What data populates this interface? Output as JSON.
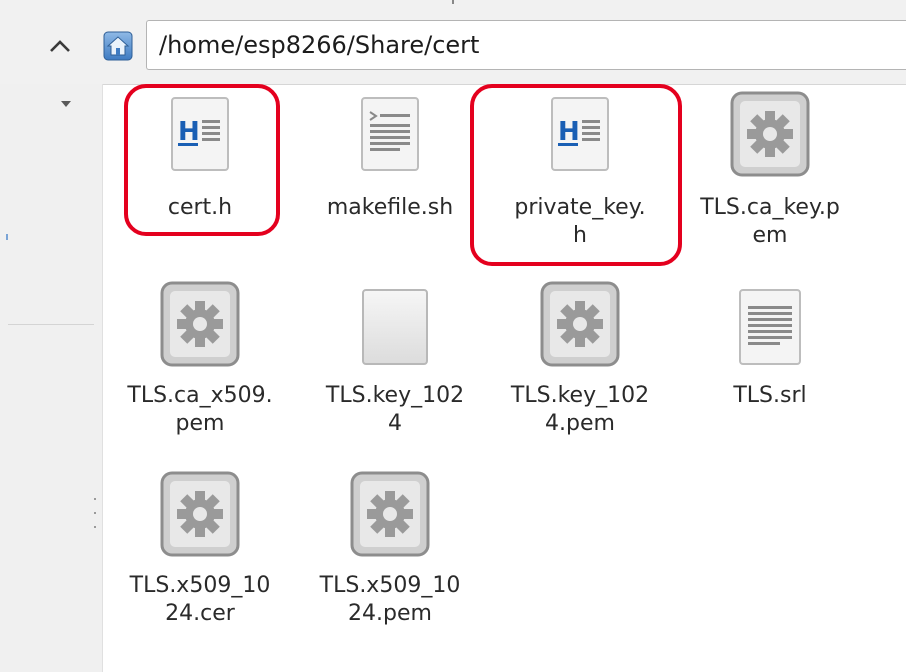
{
  "toolbar": {
    "path": "/home/esp8266/Share/cert"
  },
  "files": [
    {
      "name_line1": "cert.h",
      "name_line2": "",
      "type": "header"
    },
    {
      "name_line1": "makefile.sh",
      "name_line2": "",
      "type": "script"
    },
    {
      "name_line1": "private_key.",
      "name_line2": "h",
      "type": "header"
    },
    {
      "name_line1": "TLS.ca_key.p",
      "name_line2": "em",
      "type": "gear"
    },
    {
      "name_line1": "TLS.ca_x509.",
      "name_line2": "pem",
      "type": "gear"
    },
    {
      "name_line1": "TLS.key_102",
      "name_line2": "4",
      "type": "blank"
    },
    {
      "name_line1": "TLS.key_102",
      "name_line2": "4.pem",
      "type": "gear"
    },
    {
      "name_line1": "TLS.srl",
      "name_line2": "",
      "type": "text"
    },
    {
      "name_line1": "TLS.x509_10",
      "name_line2": "24.cer",
      "type": "gear"
    },
    {
      "name_line1": "TLS.x509_10",
      "name_line2": "24.pem",
      "type": "gear"
    }
  ],
  "colors": {
    "highlight": "#e4001e",
    "header_icon_letter": "#1a5fb4"
  },
  "icons": {
    "up": "chevron-up-icon",
    "home": "home-icon",
    "header": "c-header-file-icon",
    "script": "shell-script-file-icon",
    "gear": "gear-file-icon",
    "blank": "blank-file-icon",
    "text": "text-file-icon"
  }
}
